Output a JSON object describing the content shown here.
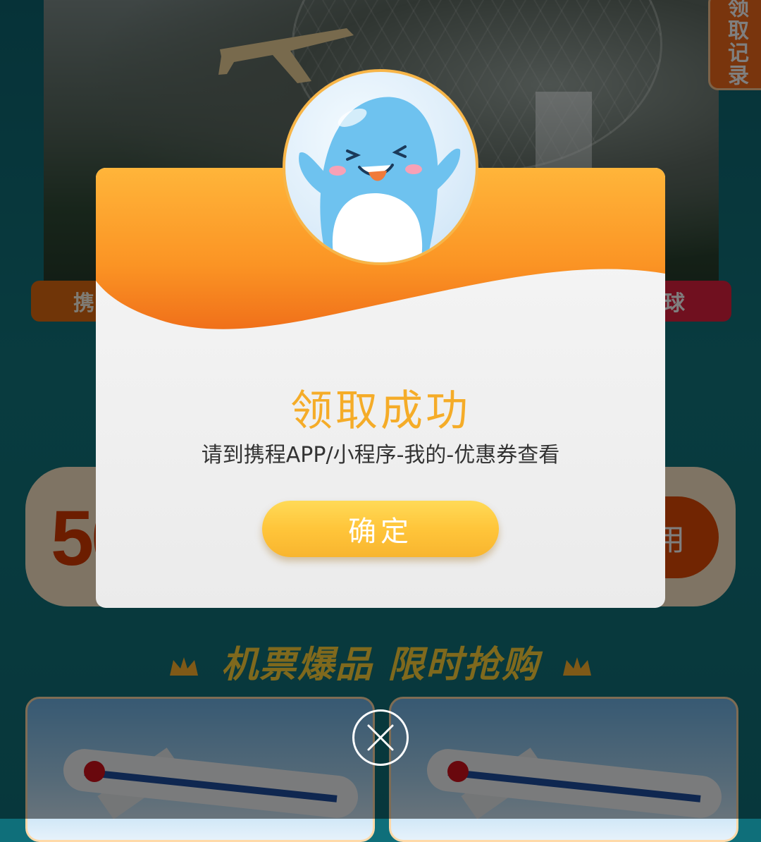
{
  "background": {
    "record_tab_label": "领取记录",
    "pill_left_label": "携",
    "pill_right_label": "球",
    "coupon_amount": "50",
    "coupon_action": "用",
    "section_title": "机票爆品 限时抢购"
  },
  "modal": {
    "title": "领取成功",
    "message": "请到携程APP/小程序-我的-优惠券查看",
    "confirm_label": "确定"
  },
  "colors": {
    "title": "#f5ac28",
    "button": "#ffc53a",
    "header_orange": "#f98a1c"
  },
  "icons": {
    "mascot": "dolphin-mascot-icon",
    "close": "close-icon"
  }
}
